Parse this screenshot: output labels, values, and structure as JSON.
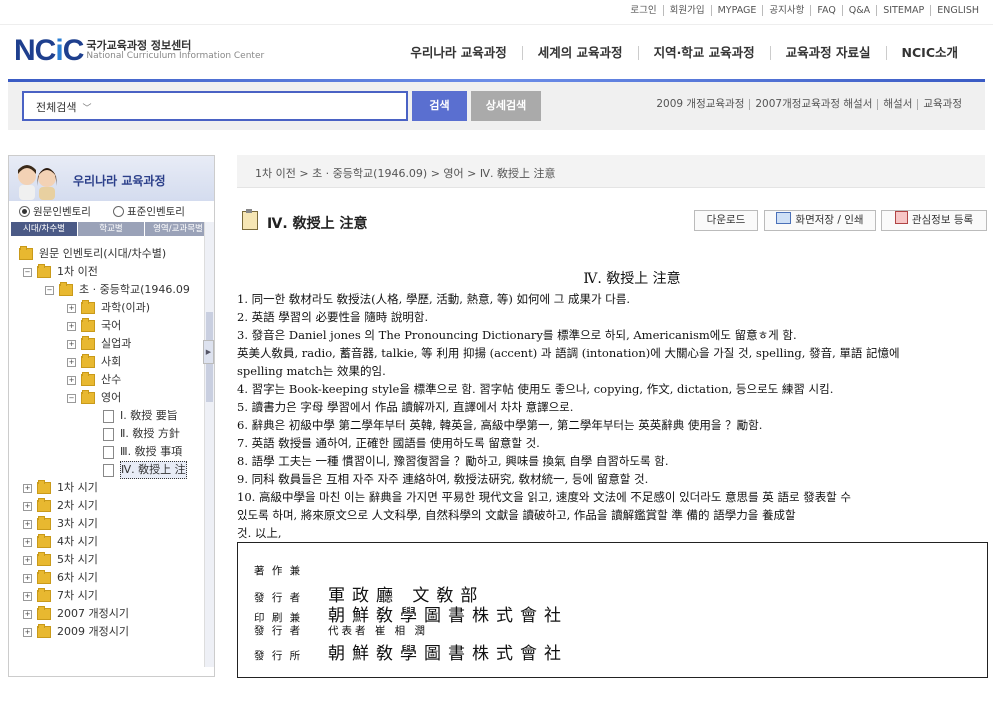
{
  "util_nav": [
    "로그인",
    "회원가입",
    "MYPAGE",
    "공지사항",
    "FAQ",
    "Q&A",
    "SITEMAP",
    "ENGLISH"
  ],
  "logo": {
    "mark_a": "NC",
    "mark_b": "i",
    "mark_c": "C",
    "ko": "국가교육과정 정보센터",
    "en": "National Curriculum Information Center"
  },
  "gnb": [
    "우리나라 교육과정",
    "세계의 교육과정",
    "지역·학교 교육과정",
    "교육과정 자료실",
    "NCIC소개"
  ],
  "search": {
    "category": "전체검색",
    "search_label": "검색",
    "advanced_label": "상세검색"
  },
  "quicklinks": [
    "2009 개정교육과정",
    "2007개정교육과정 해설서",
    "해설서",
    "교육과정"
  ],
  "sidebar": {
    "title": "우리나라 교육과정",
    "radio_original": "원문인벤토리",
    "radio_standard": "표준인벤토리",
    "tabs": [
      "시대/차수별",
      "학교별",
      "영역/교과목별"
    ],
    "tree": [
      {
        "label": "원문 인벤토리(시대/차수별)",
        "type": "folder",
        "level": 0,
        "pm": ""
      },
      {
        "label": "1차 이전",
        "type": "folder",
        "level": 1,
        "pm": "−"
      },
      {
        "label": "초 · 중등학교(1946.09",
        "type": "folder",
        "level": 2,
        "pm": "−"
      },
      {
        "label": "과학(이과)",
        "type": "folder",
        "level": 3,
        "pm": "+"
      },
      {
        "label": "국어",
        "type": "folder",
        "level": 3,
        "pm": "+"
      },
      {
        "label": "실업과",
        "type": "folder",
        "level": 3,
        "pm": "+"
      },
      {
        "label": "사회",
        "type": "folder",
        "level": 3,
        "pm": "+"
      },
      {
        "label": "산수",
        "type": "folder",
        "level": 3,
        "pm": "+"
      },
      {
        "label": "영어",
        "type": "folder",
        "level": 3,
        "pm": "−"
      },
      {
        "label": "Ⅰ. 敎授 要旨",
        "type": "doc",
        "level": 4,
        "pm": ""
      },
      {
        "label": "Ⅱ. 敎授 方針",
        "type": "doc",
        "level": 4,
        "pm": ""
      },
      {
        "label": "Ⅲ. 敎授 事項",
        "type": "doc",
        "level": 4,
        "pm": ""
      },
      {
        "label": "Ⅳ. 敎授上 注",
        "type": "doc",
        "level": 4,
        "pm": "",
        "selected": true
      },
      {
        "label": "1차 시기",
        "type": "folder",
        "level": 1,
        "pm": "+"
      },
      {
        "label": "2차 시기",
        "type": "folder",
        "level": 1,
        "pm": "+"
      },
      {
        "label": "3차 시기",
        "type": "folder",
        "level": 1,
        "pm": "+"
      },
      {
        "label": "4차 시기",
        "type": "folder",
        "level": 1,
        "pm": "+"
      },
      {
        "label": "5차 시기",
        "type": "folder",
        "level": 1,
        "pm": "+"
      },
      {
        "label": "6차 시기",
        "type": "folder",
        "level": 1,
        "pm": "+"
      },
      {
        "label": "7차 시기",
        "type": "folder",
        "level": 1,
        "pm": "+"
      },
      {
        "label": "2007 개정시기",
        "type": "folder",
        "level": 1,
        "pm": "+"
      },
      {
        "label": "2009 개정시기",
        "type": "folder",
        "level": 1,
        "pm": "+"
      }
    ]
  },
  "breadcrumb": "1차 이전 > 초 · 중등학교(1946.09) > 영어 > Ⅳ. 敎授上 注意",
  "page": {
    "title": "Ⅳ. 敎授上 注意",
    "download_label": "다운로드",
    "print_label": "화면저장 / 인쇄",
    "favorite_label": "관심정보 등록"
  },
  "document": {
    "heading": "Ⅳ. 敎授上 注意",
    "lines": [
      "1. 同一한 敎材라도 敎授法(人格, 學歷, 活動, 熱意, 等) 如何에 그 成果가 다름.",
      "2. 英語 學習의 必要性을 隨時 說明함.",
      "3. 發音은 Daniel jones 의 The Pronouncing Dictionary를 標準으로 하되, Americanism에도 留意ㅎ게 함.",
      "  英美人敎員, radio, 蓄音器, talkie, 等 利用 抑揚 (accent) 과 語調 (intonation)에 大關心을 가질 것, spelling, 發音, 單語 記憶에",
      "spelling match는 效果的임.",
      "4. 習字는 Book-keeping style을 標準으로 함. 習字帖 使用도 좋으나, copying, 作文, dictation, 등으로도 練習 시킴.",
      "5. 讀書力은 字母 學習에서 作品 讀解까지, 直譯에서 차차 意譯으로.",
      "6. 辭典은 初級中學 第二學年부터 英韓, 韓英을, 高級中學第一, 第二學年부터는 英英辭典 使用을 ？勵함.",
      "7. 英語 敎授를 通하여, 正確한 國語를 使用하도록 留意할 것.",
      "8. 語學 工夫는 一種 慣習이니, 豫習復習을 ？勵하고, 興味를 換氣 自學 自習하도록 함.",
      "9. 同科 敎員들은 互相 자주 자주 連絡하여, 敎授法硏究, 敎材統一, 등에 留意할 것.",
      "10. 高級中學을 마친 이는 辭典을 가지면 平易한 現代文을 읽고, 速度와 文法에 不足感이 있더라도 意思를 英 語로 發表할 수",
      "있도록 하며, 將來原文으로 人文科學, 自然科學의 文獻을 讀破하고, 作品을 讀解鑑賞할 準 備的 語學力을 養成할",
      "것.                                                                        以上,"
    ]
  },
  "colophon": [
    {
      "key": "著 作 兼",
      "value": "",
      "small": false
    },
    {
      "key": "發 行 者",
      "value": "軍政廳 文敎部",
      "small": false
    },
    {
      "key": "印 刷 兼",
      "value": "朝鮮敎學圖書株式會社",
      "small": false
    },
    {
      "key": "發 行 者",
      "value": "代表者   崔 相 潤",
      "small": true
    },
    {
      "key": "發 行 所",
      "value": "朝鮮敎學圖書株式會社",
      "small": false
    }
  ],
  "colors": {
    "brand": "#1e3f8e",
    "accent": "#5a6fd0",
    "tab_active": "#4b5a86"
  }
}
